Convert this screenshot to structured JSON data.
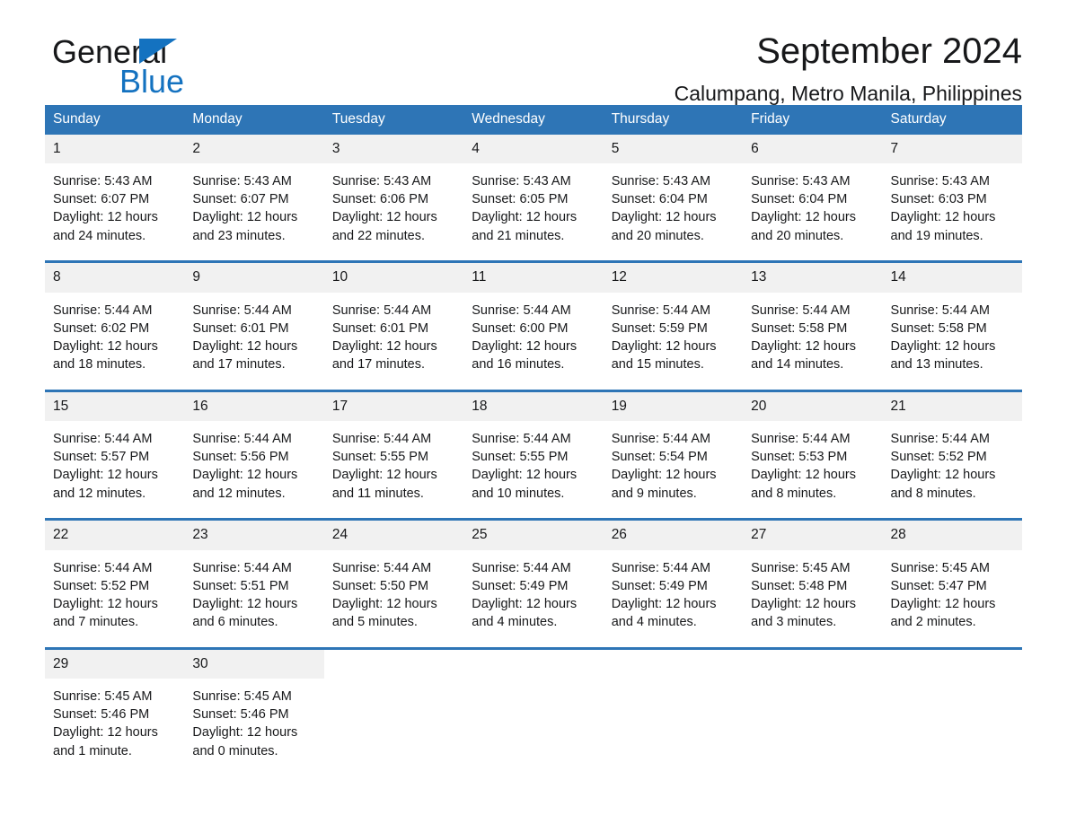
{
  "brand": {
    "name_part1": "General",
    "name_part2": "Blue",
    "accent_color": "#1472c0"
  },
  "header": {
    "title": "September 2024",
    "subtitle": "Calumpang, Metro Manila, Philippines"
  },
  "theme": {
    "header_row_bg": "#2e75b6",
    "header_row_text": "#ffffff",
    "daynum_bg": "#f1f1f1",
    "row_divider": "#2e75b6"
  },
  "weekday_headers": [
    "Sunday",
    "Monday",
    "Tuesday",
    "Wednesday",
    "Thursday",
    "Friday",
    "Saturday"
  ],
  "weeks": [
    {
      "days": [
        {
          "day": "1",
          "sunrise": "Sunrise: 5:43 AM",
          "sunset": "Sunset: 6:07 PM",
          "daylight_line1": "Daylight: 12 hours",
          "daylight_line2": "and 24 minutes."
        },
        {
          "day": "2",
          "sunrise": "Sunrise: 5:43 AM",
          "sunset": "Sunset: 6:07 PM",
          "daylight_line1": "Daylight: 12 hours",
          "daylight_line2": "and 23 minutes."
        },
        {
          "day": "3",
          "sunrise": "Sunrise: 5:43 AM",
          "sunset": "Sunset: 6:06 PM",
          "daylight_line1": "Daylight: 12 hours",
          "daylight_line2": "and 22 minutes."
        },
        {
          "day": "4",
          "sunrise": "Sunrise: 5:43 AM",
          "sunset": "Sunset: 6:05 PM",
          "daylight_line1": "Daylight: 12 hours",
          "daylight_line2": "and 21 minutes."
        },
        {
          "day": "5",
          "sunrise": "Sunrise: 5:43 AM",
          "sunset": "Sunset: 6:04 PM",
          "daylight_line1": "Daylight: 12 hours",
          "daylight_line2": "and 20 minutes."
        },
        {
          "day": "6",
          "sunrise": "Sunrise: 5:43 AM",
          "sunset": "Sunset: 6:04 PM",
          "daylight_line1": "Daylight: 12 hours",
          "daylight_line2": "and 20 minutes."
        },
        {
          "day": "7",
          "sunrise": "Sunrise: 5:43 AM",
          "sunset": "Sunset: 6:03 PM",
          "daylight_line1": "Daylight: 12 hours",
          "daylight_line2": "and 19 minutes."
        }
      ]
    },
    {
      "days": [
        {
          "day": "8",
          "sunrise": "Sunrise: 5:44 AM",
          "sunset": "Sunset: 6:02 PM",
          "daylight_line1": "Daylight: 12 hours",
          "daylight_line2": "and 18 minutes."
        },
        {
          "day": "9",
          "sunrise": "Sunrise: 5:44 AM",
          "sunset": "Sunset: 6:01 PM",
          "daylight_line1": "Daylight: 12 hours",
          "daylight_line2": "and 17 minutes."
        },
        {
          "day": "10",
          "sunrise": "Sunrise: 5:44 AM",
          "sunset": "Sunset: 6:01 PM",
          "daylight_line1": "Daylight: 12 hours",
          "daylight_line2": "and 17 minutes."
        },
        {
          "day": "11",
          "sunrise": "Sunrise: 5:44 AM",
          "sunset": "Sunset: 6:00 PM",
          "daylight_line1": "Daylight: 12 hours",
          "daylight_line2": "and 16 minutes."
        },
        {
          "day": "12",
          "sunrise": "Sunrise: 5:44 AM",
          "sunset": "Sunset: 5:59 PM",
          "daylight_line1": "Daylight: 12 hours",
          "daylight_line2": "and 15 minutes."
        },
        {
          "day": "13",
          "sunrise": "Sunrise: 5:44 AM",
          "sunset": "Sunset: 5:58 PM",
          "daylight_line1": "Daylight: 12 hours",
          "daylight_line2": "and 14 minutes."
        },
        {
          "day": "14",
          "sunrise": "Sunrise: 5:44 AM",
          "sunset": "Sunset: 5:58 PM",
          "daylight_line1": "Daylight: 12 hours",
          "daylight_line2": "and 13 minutes."
        }
      ]
    },
    {
      "days": [
        {
          "day": "15",
          "sunrise": "Sunrise: 5:44 AM",
          "sunset": "Sunset: 5:57 PM",
          "daylight_line1": "Daylight: 12 hours",
          "daylight_line2": "and 12 minutes."
        },
        {
          "day": "16",
          "sunrise": "Sunrise: 5:44 AM",
          "sunset": "Sunset: 5:56 PM",
          "daylight_line1": "Daylight: 12 hours",
          "daylight_line2": "and 12 minutes."
        },
        {
          "day": "17",
          "sunrise": "Sunrise: 5:44 AM",
          "sunset": "Sunset: 5:55 PM",
          "daylight_line1": "Daylight: 12 hours",
          "daylight_line2": "and 11 minutes."
        },
        {
          "day": "18",
          "sunrise": "Sunrise: 5:44 AM",
          "sunset": "Sunset: 5:55 PM",
          "daylight_line1": "Daylight: 12 hours",
          "daylight_line2": "and 10 minutes."
        },
        {
          "day": "19",
          "sunrise": "Sunrise: 5:44 AM",
          "sunset": "Sunset: 5:54 PM",
          "daylight_line1": "Daylight: 12 hours",
          "daylight_line2": "and 9 minutes."
        },
        {
          "day": "20",
          "sunrise": "Sunrise: 5:44 AM",
          "sunset": "Sunset: 5:53 PM",
          "daylight_line1": "Daylight: 12 hours",
          "daylight_line2": "and 8 minutes."
        },
        {
          "day": "21",
          "sunrise": "Sunrise: 5:44 AM",
          "sunset": "Sunset: 5:52 PM",
          "daylight_line1": "Daylight: 12 hours",
          "daylight_line2": "and 8 minutes."
        }
      ]
    },
    {
      "days": [
        {
          "day": "22",
          "sunrise": "Sunrise: 5:44 AM",
          "sunset": "Sunset: 5:52 PM",
          "daylight_line1": "Daylight: 12 hours",
          "daylight_line2": "and 7 minutes."
        },
        {
          "day": "23",
          "sunrise": "Sunrise: 5:44 AM",
          "sunset": "Sunset: 5:51 PM",
          "daylight_line1": "Daylight: 12 hours",
          "daylight_line2": "and 6 minutes."
        },
        {
          "day": "24",
          "sunrise": "Sunrise: 5:44 AM",
          "sunset": "Sunset: 5:50 PM",
          "daylight_line1": "Daylight: 12 hours",
          "daylight_line2": "and 5 minutes."
        },
        {
          "day": "25",
          "sunrise": "Sunrise: 5:44 AM",
          "sunset": "Sunset: 5:49 PM",
          "daylight_line1": "Daylight: 12 hours",
          "daylight_line2": "and 4 minutes."
        },
        {
          "day": "26",
          "sunrise": "Sunrise: 5:44 AM",
          "sunset": "Sunset: 5:49 PM",
          "daylight_line1": "Daylight: 12 hours",
          "daylight_line2": "and 4 minutes."
        },
        {
          "day": "27",
          "sunrise": "Sunrise: 5:45 AM",
          "sunset": "Sunset: 5:48 PM",
          "daylight_line1": "Daylight: 12 hours",
          "daylight_line2": "and 3 minutes."
        },
        {
          "day": "28",
          "sunrise": "Sunrise: 5:45 AM",
          "sunset": "Sunset: 5:47 PM",
          "daylight_line1": "Daylight: 12 hours",
          "daylight_line2": "and 2 minutes."
        }
      ]
    },
    {
      "days": [
        {
          "day": "29",
          "sunrise": "Sunrise: 5:45 AM",
          "sunset": "Sunset: 5:46 PM",
          "daylight_line1": "Daylight: 12 hours",
          "daylight_line2": "and 1 minute."
        },
        {
          "day": "30",
          "sunrise": "Sunrise: 5:45 AM",
          "sunset": "Sunset: 5:46 PM",
          "daylight_line1": "Daylight: 12 hours",
          "daylight_line2": "and 0 minutes."
        },
        {
          "day": "",
          "sunrise": "",
          "sunset": "",
          "daylight_line1": "",
          "daylight_line2": ""
        },
        {
          "day": "",
          "sunrise": "",
          "sunset": "",
          "daylight_line1": "",
          "daylight_line2": ""
        },
        {
          "day": "",
          "sunrise": "",
          "sunset": "",
          "daylight_line1": "",
          "daylight_line2": ""
        },
        {
          "day": "",
          "sunrise": "",
          "sunset": "",
          "daylight_line1": "",
          "daylight_line2": ""
        },
        {
          "day": "",
          "sunrise": "",
          "sunset": "",
          "daylight_line1": "",
          "daylight_line2": ""
        }
      ]
    }
  ]
}
